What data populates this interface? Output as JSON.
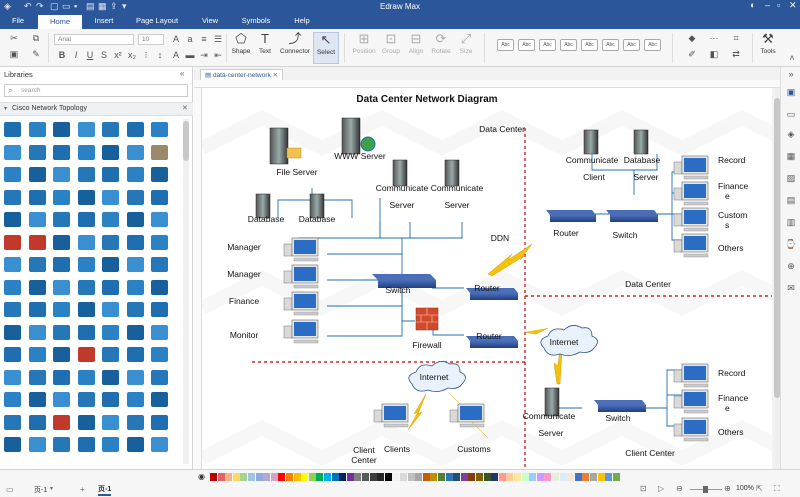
{
  "app": {
    "title": "Edraw Max"
  },
  "menus": [
    "File",
    "Home",
    "Insert",
    "Page Layout",
    "View",
    "Symbols",
    "Help"
  ],
  "active_menu": "Home",
  "ribbon": {
    "font_name": "Arial",
    "font_size": "10",
    "big_buttons": {
      "shape": "Shape",
      "text": "Text",
      "connector": "Connector",
      "select": "Select"
    },
    "dim_buttons": {
      "position": "Position",
      "group": "Group",
      "align": "Align",
      "rotate": "Rotate",
      "size": "Size"
    },
    "style_swatch_label": "Abc",
    "tools": "Tools"
  },
  "libraries": {
    "header": "Libraries",
    "search_placeholder": "search",
    "category": "Cisco Network Topology"
  },
  "document": {
    "tab": "data-center-network"
  },
  "diagram": {
    "title": "Data Center Network Diagram",
    "labels": {
      "data_center_top": "Data Center",
      "data_center_right": "Data Center",
      "client_center_left_1": "Client",
      "client_center_left_2": "Center",
      "client_center_right": "Client Center",
      "file_server": "File Server",
      "www_server": "WWW Server",
      "database_1": "Database",
      "database_2": "Database",
      "comm_server_1a": "Communicate",
      "comm_server_1b": "Server",
      "comm_server_2a": "Communicate",
      "comm_server_2b": "Server",
      "manager_1": "Manager",
      "manager_2": "Manager",
      "finance": "Finance",
      "monitor": "Monitor",
      "switch_center": "Switch",
      "router_center": "Router",
      "ddn": "DDN",
      "firewall": "Firewall",
      "router_lower": "Router",
      "internet_left": "Internet",
      "clients": "Clients",
      "customs": "Customs",
      "comm_client_a": "Communicate",
      "comm_client_b": "Client",
      "database_right_a": "Database",
      "database_right_b": "Server",
      "router_right": "Router",
      "switch_right": "Switch",
      "record_top": "Record",
      "finance_top_1": "Finance",
      "finance_top_2": "e",
      "custom_1": "Custom",
      "custom_2": "s",
      "others_top": "Others",
      "internet_right": "Internet",
      "comm_server_3a": "Communicate",
      "comm_server_3b": "Server",
      "switch_lower_right": "Switch",
      "record_bottom": "Record",
      "finance_bottom_1": "Finance",
      "finance_bottom_2": "e",
      "others_bottom": "Others"
    }
  },
  "status": {
    "page_left": "页-1",
    "page_tab": "页-1",
    "zoom": "100%"
  },
  "colors": {
    "brand": "#2b579a",
    "device_blue": "#2d4f96",
    "separator_red": "#c00000",
    "connector": "#1f6fb0"
  }
}
